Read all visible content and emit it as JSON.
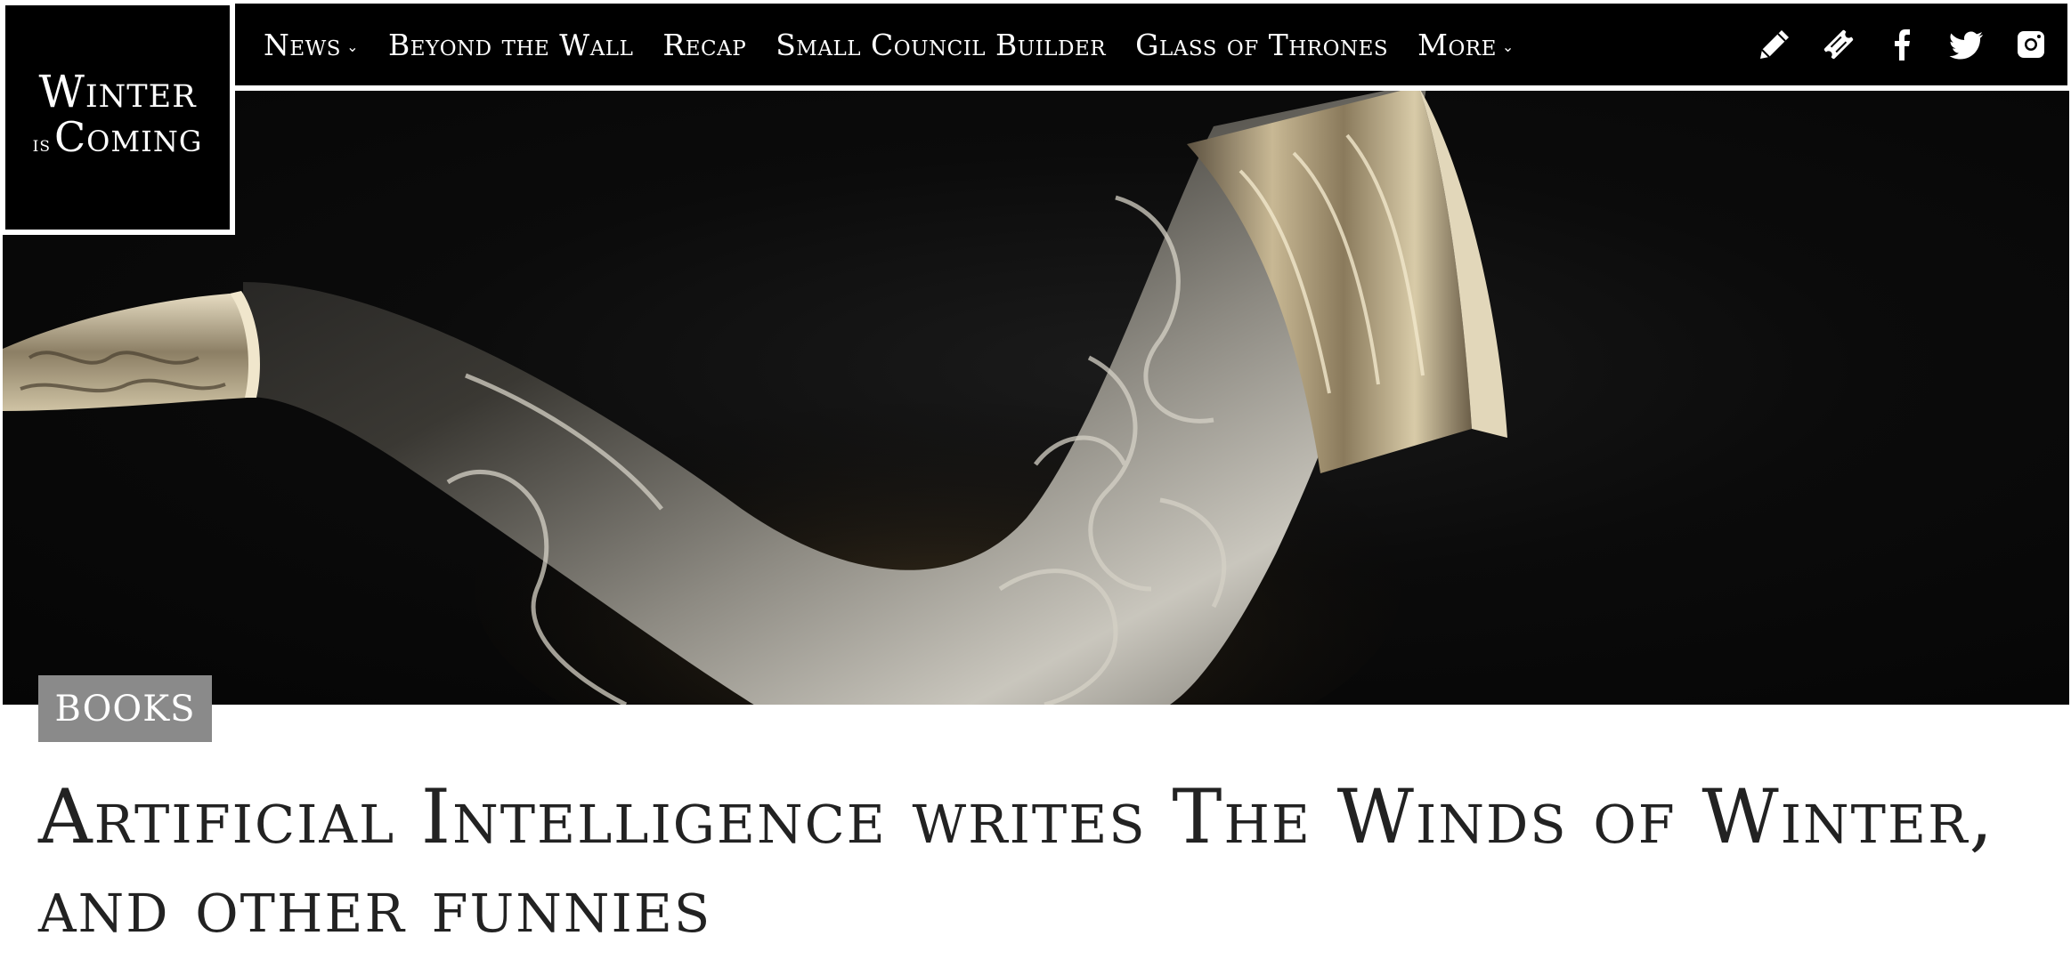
{
  "logo": {
    "line1": "Winter",
    "is": "is",
    "line2": "Coming"
  },
  "nav": {
    "items": [
      {
        "label": "News",
        "dropdown": true
      },
      {
        "label": "Beyond the Wall",
        "dropdown": false
      },
      {
        "label": "Recap",
        "dropdown": false
      },
      {
        "label": "Small Council Builder",
        "dropdown": false
      },
      {
        "label": "Glass of Thrones",
        "dropdown": false
      },
      {
        "label": "More",
        "dropdown": true
      }
    ],
    "icons": [
      "pencil-icon",
      "ticket-icon",
      "facebook-icon",
      "twitter-icon",
      "instagram-icon"
    ]
  },
  "hero": {
    "subject": "drinking horn"
  },
  "article": {
    "category": "BOOKS",
    "title": "Artificial Intelligence writes The Winds of Winter, and other funnies"
  },
  "colors": {
    "nav_bg": "#000000",
    "badge_bg": "#8a8a8a",
    "title": "#222222"
  }
}
